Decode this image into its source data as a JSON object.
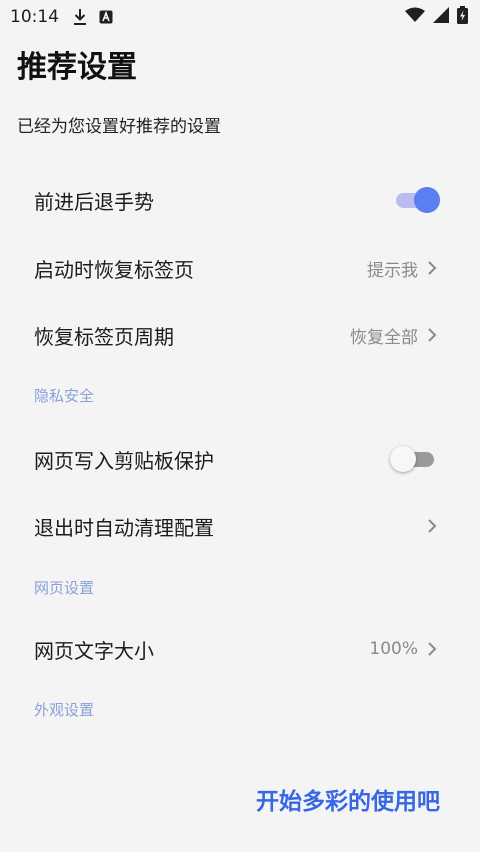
{
  "status_bar": {
    "time": "10:14",
    "icons": [
      "download-icon",
      "app-notification-icon",
      "wifi-icon",
      "signal-icon",
      "battery-charging-icon"
    ]
  },
  "header": {
    "title": "推荐设置",
    "subtitle": "已经为您设置好推荐的设置"
  },
  "settings": {
    "gesture": {
      "label": "前进后退手势",
      "enabled": true
    },
    "restore_on_start": {
      "label": "启动时恢复标签页",
      "value": "提示我"
    },
    "restore_period": {
      "label": "恢复标签页周期",
      "value": "恢复全部"
    },
    "privacy_section": "隐私安全",
    "clipboard_protect": {
      "label": "网页写入剪贴板保护",
      "enabled": false
    },
    "auto_clean": {
      "label": "退出时自动清理配置"
    },
    "web_section": "网页设置",
    "font_size": {
      "label": "网页文字大小",
      "value": "100%"
    },
    "appearance_section": "外观设置",
    "partial_row": {
      "enabled": true
    }
  },
  "colors": {
    "accent": "#5b7ef0",
    "section_header": "#8aa0d8",
    "action": "#3867e6",
    "background": "#f4f4f4"
  },
  "footer": {
    "start_label": "开始多彩的使用吧"
  }
}
